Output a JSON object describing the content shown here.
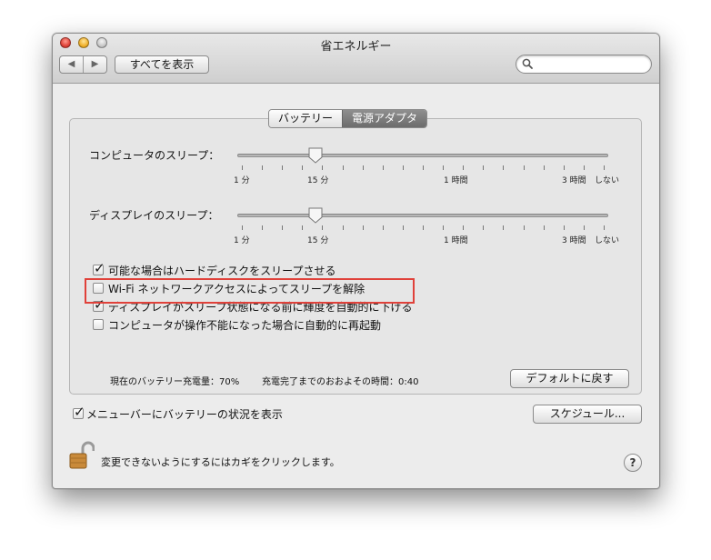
{
  "window": {
    "title": "省エネルギー"
  },
  "toolbar": {
    "back_icon": "◀",
    "forward_icon": "▶",
    "show_all_label": "すべてを表示",
    "search_placeholder": ""
  },
  "tabs": [
    {
      "label": "バッテリー",
      "selected": false
    },
    {
      "label": "電源アダプタ",
      "selected": true
    }
  ],
  "computer_sleep": {
    "label": "コンピュータのスリープ：",
    "value": "15 分"
  },
  "display_sleep": {
    "label": "ディスプレイのスリープ：",
    "value": "15 分"
  },
  "slider_scale": {
    "labels": [
      "1 分",
      "15 分",
      "1 時間",
      "3 時間",
      "しない"
    ]
  },
  "options": [
    {
      "label": "可能な場合はハードディスクをスリープさせる",
      "checked": true
    },
    {
      "label": "Wi-Fi ネットワークアクセスによってスリープを解除",
      "checked": false
    },
    {
      "label": "ディスプレイがスリープ状態になる前に輝度を自動的に下げる",
      "checked": true
    },
    {
      "label": "コンピュータが操作不能になった場合に自動的に再起動",
      "checked": false
    }
  ],
  "status": {
    "battery": "現在のバッテリー充電量：70%",
    "charge_time": "充電完了までのおおよその時間：0:40"
  },
  "buttons": {
    "defaults": "デフォルトに戻す",
    "schedule": "スケジュール..."
  },
  "menu_battery": {
    "label": "メニューバーにバッテリーの状況を表示",
    "checked": true
  },
  "lock": {
    "text": "変更できないようにするにはカギをクリックします。"
  },
  "help": {
    "label": "?"
  },
  "colors": {
    "annotation": "#e0413a",
    "selected_tab": "#7a7a7a"
  }
}
